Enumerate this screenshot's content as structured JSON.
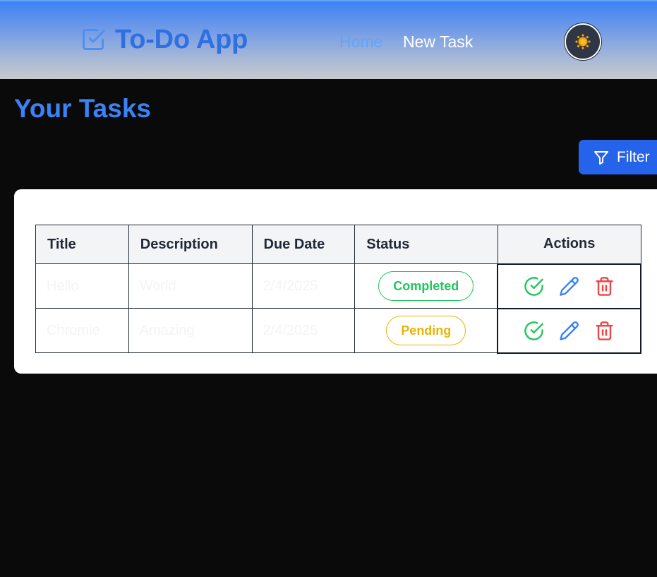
{
  "nav": {
    "brand": "To-Do App",
    "brand_icon": "checkbox-icon",
    "links": [
      {
        "label": "Home",
        "active": true
      },
      {
        "label": "New Task",
        "active": false
      }
    ],
    "theme_icon": "sun-icon"
  },
  "page": {
    "title": "Your Tasks",
    "filter_label": "Filter",
    "filter_icon": "filter-icon"
  },
  "table": {
    "headers": [
      "Title",
      "Description",
      "Due Date",
      "Status",
      "Actions"
    ],
    "rows": [
      {
        "title": "Hello",
        "description": "World",
        "due_date": "2/4/2025",
        "status": "Completed"
      },
      {
        "title": "Chromie",
        "description": "Amazing",
        "due_date": "2/4/2025",
        "status": "Pending"
      }
    ],
    "action_icons": [
      "check-circle-icon",
      "pencil-icon",
      "trash-icon"
    ]
  },
  "colors": {
    "accent": "#3b82f6",
    "button": "#2563eb",
    "completed": "#22c55e",
    "pending": "#eab308",
    "delete": "#ef4444",
    "background": "#0a0a0a"
  }
}
